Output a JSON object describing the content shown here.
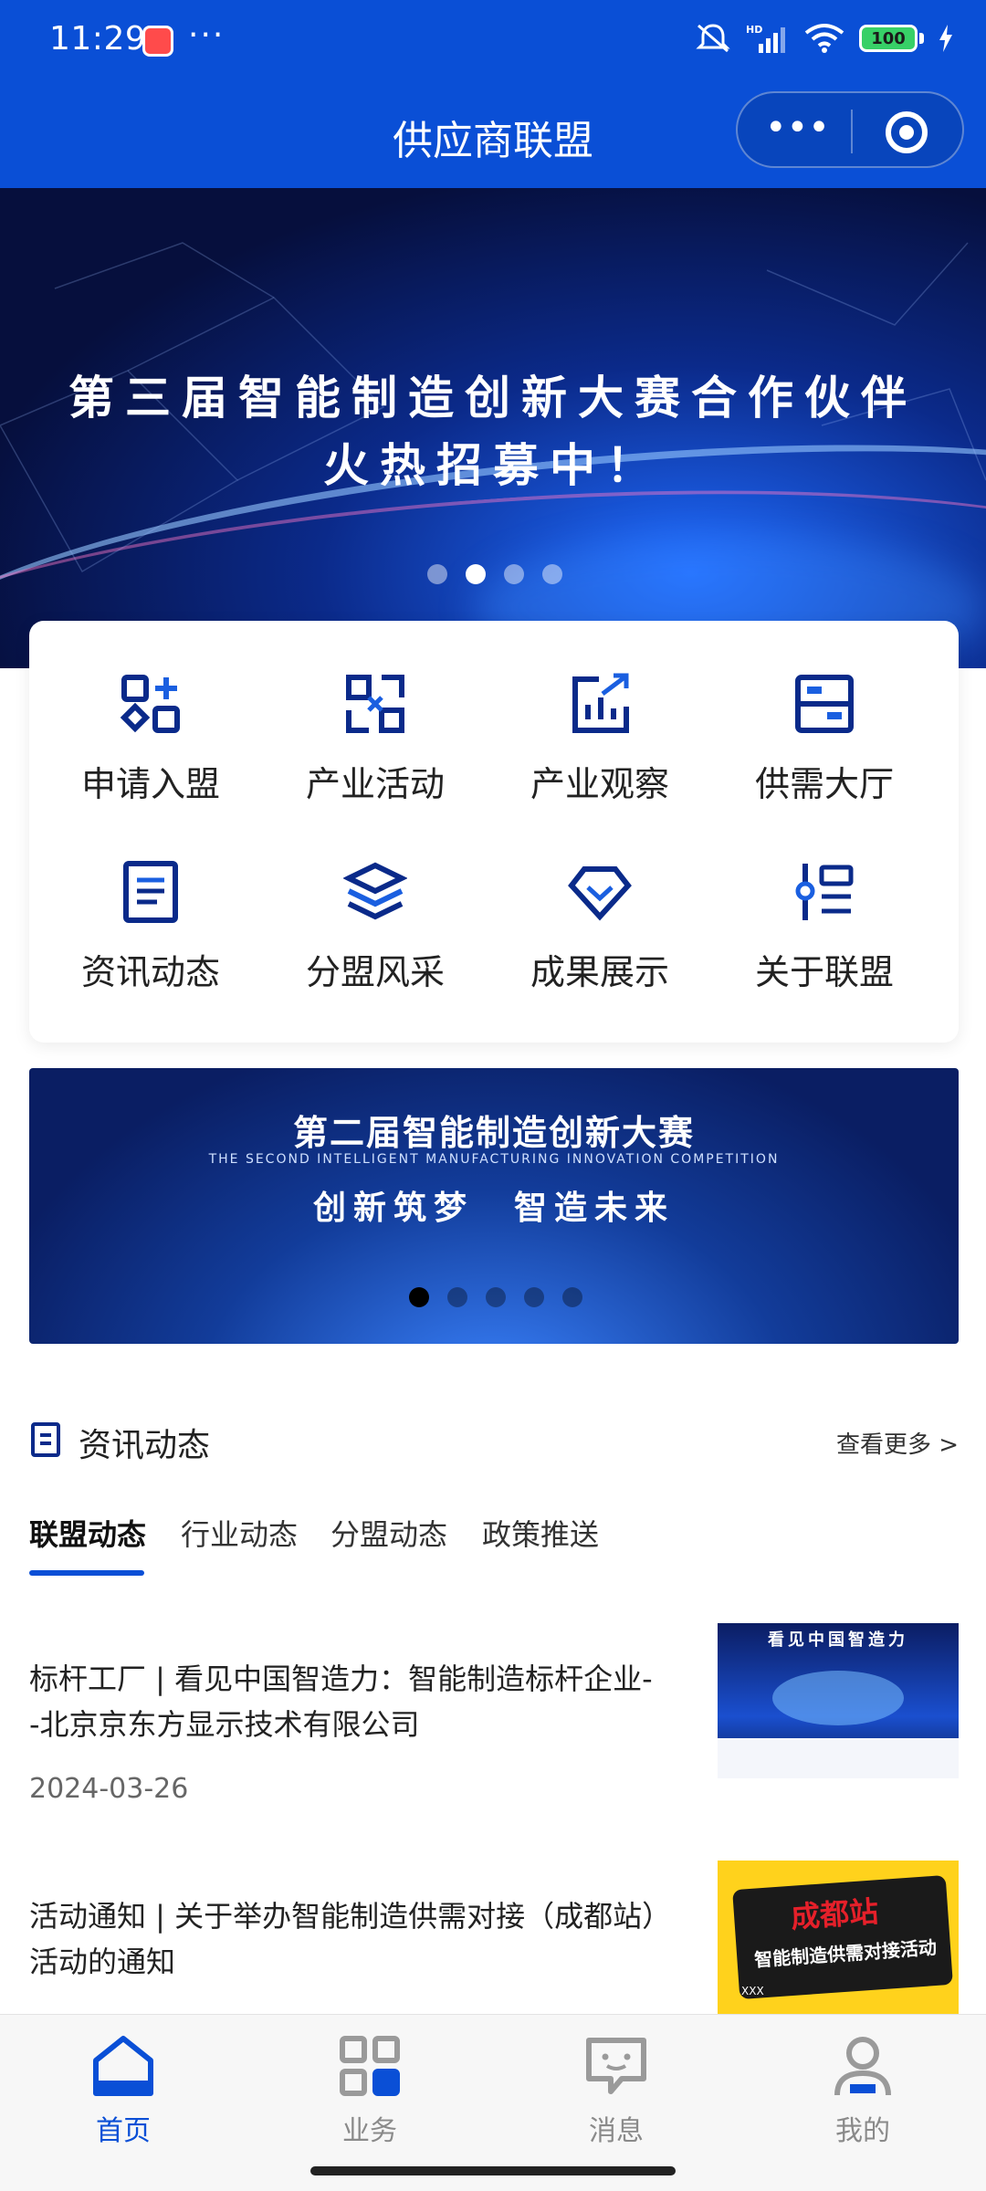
{
  "status": {
    "time": "11:29",
    "battery": "100"
  },
  "nav": {
    "title": "供应商联盟",
    "more_glyph": "•••"
  },
  "hero": {
    "line1": "第三届智能制造创新大赛合作伙伴",
    "line2": "火热招募中！"
  },
  "grid": {
    "items": [
      {
        "label": "申请入盟",
        "icon": "apps-add-icon"
      },
      {
        "label": "产业活动",
        "icon": "activity-icon"
      },
      {
        "label": "产业观察",
        "icon": "chart-trend-icon"
      },
      {
        "label": "供需大厅",
        "icon": "hall-icon"
      },
      {
        "label": "资讯动态",
        "icon": "document-icon"
      },
      {
        "label": "分盟风采",
        "icon": "layers-icon"
      },
      {
        "label": "成果展示",
        "icon": "diamond-icon"
      },
      {
        "label": "关于联盟",
        "icon": "info-list-icon"
      }
    ]
  },
  "banner2": {
    "title": "第二届智能制造创新大赛",
    "subtitle_en": "THE SECOND INTELLIGENT MANUFACTURING INNOVATION COMPETITION",
    "slogan": "创新筑梦　智造未来"
  },
  "news": {
    "section_title": "资讯动态",
    "more": "查看更多 >",
    "tabs": [
      "联盟动态",
      "行业动态",
      "分盟动态",
      "政策推送"
    ],
    "articles": [
      {
        "title": "标杆工厂 | 看见中国智造力：智能制造标杆企业--北京京东方显示技术有限公司",
        "date": "2024-03-26"
      },
      {
        "title": "活动通知 | 关于举办智能制造供需对接（成都站）活动的通知"
      }
    ]
  },
  "thumbs": {
    "t1_caption": "看见中国智造力",
    "t2_city": "成都站",
    "t2_text": "智能制造供需对接活动",
    "t2_tag": "XXX"
  },
  "tabbar": {
    "items": [
      {
        "label": "首页",
        "icon": "home-icon"
      },
      {
        "label": "业务",
        "icon": "grid-icon"
      },
      {
        "label": "消息",
        "icon": "message-icon"
      },
      {
        "label": "我的",
        "icon": "user-icon"
      }
    ]
  },
  "colors": {
    "brand": "#0a4fd6",
    "icon_navy": "#0a2a8a"
  }
}
